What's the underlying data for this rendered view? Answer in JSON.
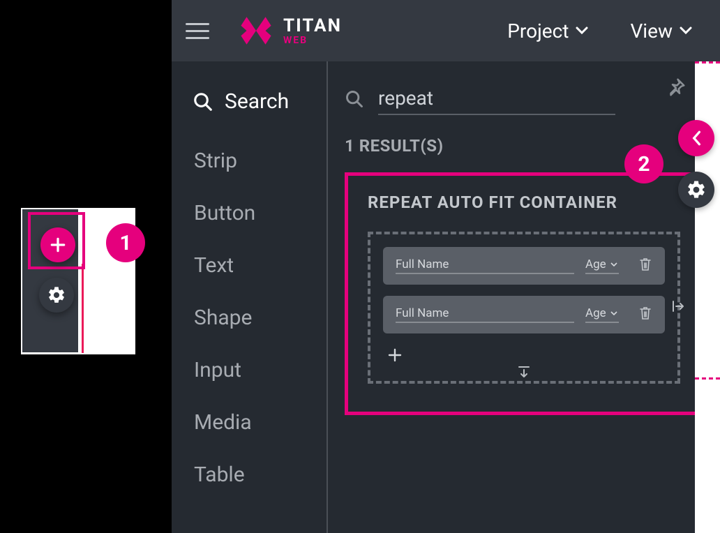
{
  "brand": {
    "name": "TITAN",
    "sub": "WEB"
  },
  "menus": {
    "project": "Project",
    "view": "View"
  },
  "sidebar": {
    "search": "Search",
    "items": [
      "Strip",
      "Button",
      "Text",
      "Shape",
      "Input",
      "Media",
      "Table"
    ]
  },
  "panel": {
    "search_value": "repeat",
    "results_count": "1 RESULT(S)",
    "result_title": "REPEAT AUTO FIT CONTAINER",
    "row_fields": {
      "name": "Full Name",
      "age": "Age"
    }
  },
  "callouts": {
    "one": "1",
    "two": "2"
  }
}
